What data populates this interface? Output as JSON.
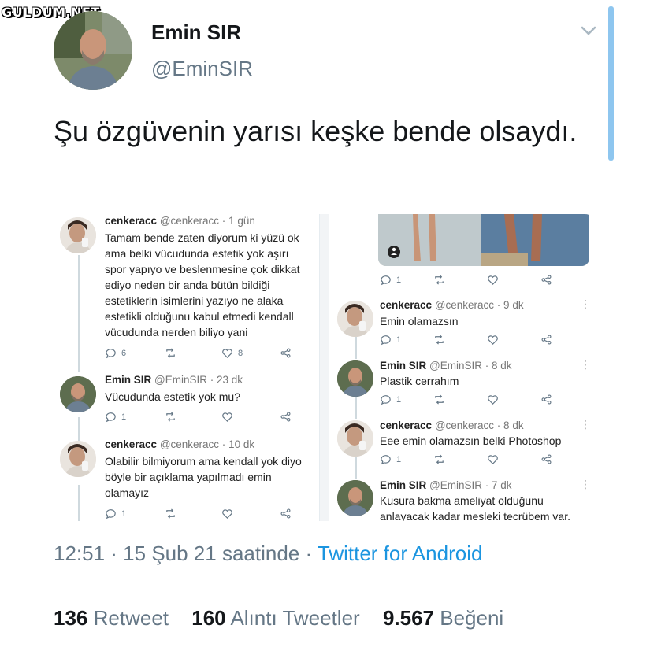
{
  "watermark": "GULDUM.NET",
  "tweet": {
    "author_name": "Emin SIR",
    "author_handle": "@EminSIR",
    "text": "Şu özgüvenin yarısı keşke bende olsaydı.",
    "timestamp": "12:51 · 15 Şub 21 saatinde · ",
    "source": "Twitter for Android"
  },
  "stats": {
    "retweets_count": "136",
    "retweets_label": "Retweet",
    "quotes_count": "160",
    "quotes_label": "Alıntı Tweetler",
    "likes_count": "9.567",
    "likes_label": "Beğeni"
  },
  "screenshot_left": {
    "replies": [
      {
        "name": "cenkeracc",
        "meta": "@cenkeracc · 1 gün",
        "text": "Tamam bende zaten diyorum ki yüzü ok\nama belki vücudunda estetik yok aşırı\nspor yapıyo ve beslenmesine çok dikkat\nediyo neden bir anda bütün bildiği\nestetiklerin isimlerini yazıyo ne alaka\nestetikli olduğunu kabul etmedi kendall\nvücudunda nerden biliyo yani",
        "reply_count": "6",
        "like_count": "8"
      },
      {
        "name": "Emin SIR",
        "meta": "@EminSIR · 23 dk",
        "text": "Vücudunda estetik yok mu?",
        "reply_count": "1",
        "like_count": ""
      },
      {
        "name": "cenkeracc",
        "meta": "@cenkeracc · 10 dk",
        "text": "Olabilir bilmiyorum ama kendall yok diyo\nböyle bir açıklama yapılmadı emin\nolamayız",
        "reply_count": "1",
        "like_count": ""
      }
    ]
  },
  "screenshot_right": {
    "top_reply_count": "1",
    "replies": [
      {
        "name": "cenkeracc",
        "meta": "@cenkeracc · 9 dk",
        "text": "Emin olamazsın",
        "reply_count": "1"
      },
      {
        "name": "Emin SIR",
        "meta": "@EminSIR · 8 dk",
        "text": "Plastik cerrahım",
        "reply_count": "1"
      },
      {
        "name": "cenkeracc",
        "meta": "@cenkeracc · 8 dk",
        "text": "Eee emin olamazsın belki Photoshop",
        "reply_count": "1"
      },
      {
        "name": "Emin SIR",
        "meta": "@EminSIR · 7 dk",
        "text": "Kusura bakma ameliyat olduğunu\nanlayacak kadar mesleki tecrübem var.",
        "reply_count": ""
      }
    ]
  },
  "colors": {
    "link": "#1b95e0",
    "muted": "#657786",
    "text": "#14171a",
    "scrollbar": "#8ec6ef"
  }
}
